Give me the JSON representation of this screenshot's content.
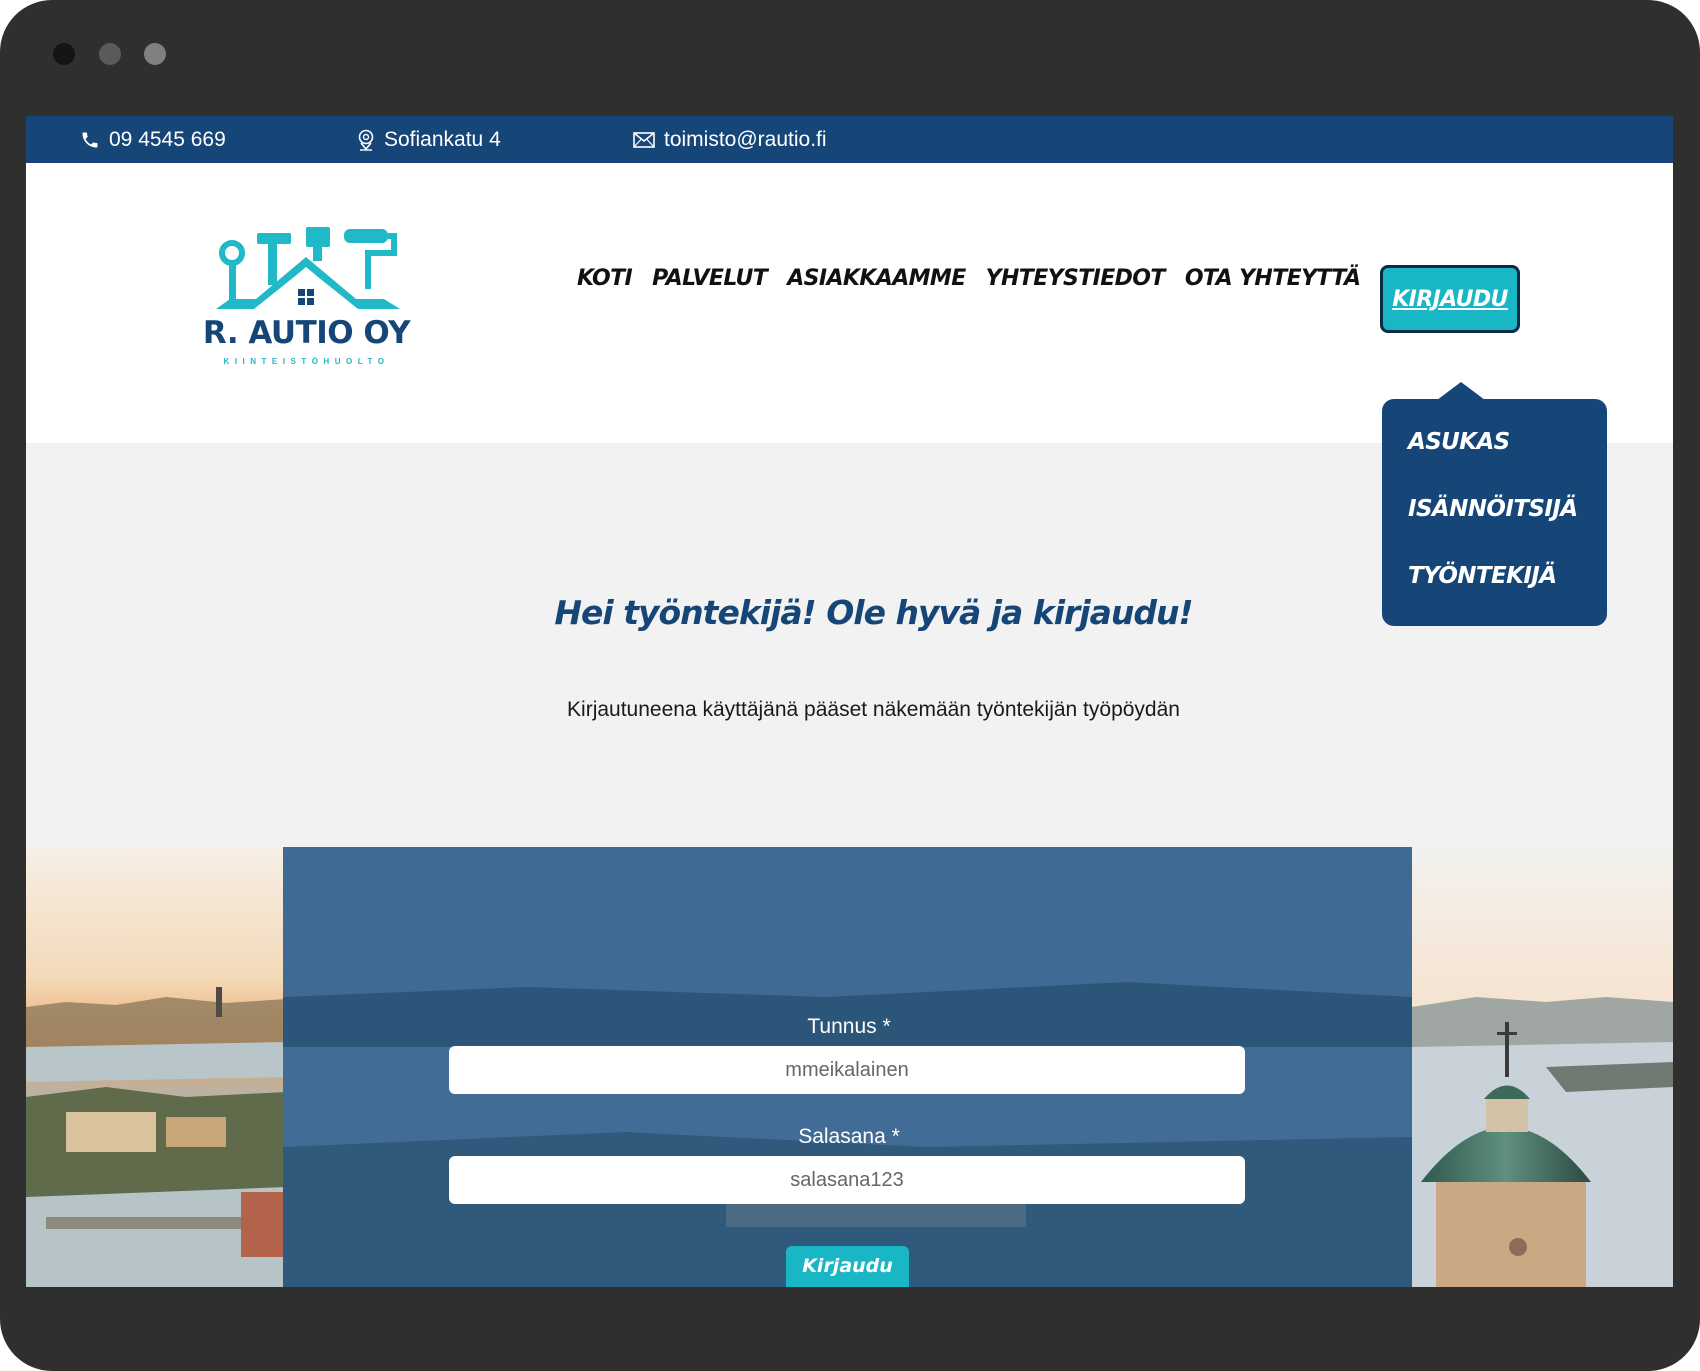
{
  "topbar": {
    "phone": "09 4545 669",
    "address": "Sofiankatu 4",
    "email": "toimisto@rautio.fi"
  },
  "logo": {
    "name": "R. AUTIO OY",
    "tagline": "KIINTEISTÖHUOLTO"
  },
  "nav": {
    "items": [
      "KOTI",
      "PALVELUT",
      "ASIAKKAAMME",
      "YHTEYSTIEDOT",
      "OTA YHTEYTTÄ"
    ],
    "login": "KIRJAUDU"
  },
  "dropdown": {
    "items": [
      "ASUKAS",
      "ISÄNNÖITSIJÄ",
      "TYÖNTEKIJÄ"
    ]
  },
  "intro": {
    "title": "Hei työntekijä! Ole hyvä ja kirjaudu!",
    "text": "Kirjautuneena käyttäjänä pääset näkemään työntekijän työpöydän"
  },
  "form": {
    "username_label": "Tunnus *",
    "username_value": "mmeikalainen",
    "password_label": "Salasana *",
    "password_value": "salasana123",
    "submit": "Kirjaudu"
  },
  "colors": {
    "brand_navy": "#164677",
    "accent_teal": "#19b6c6",
    "frame": "#2f2f2f"
  }
}
